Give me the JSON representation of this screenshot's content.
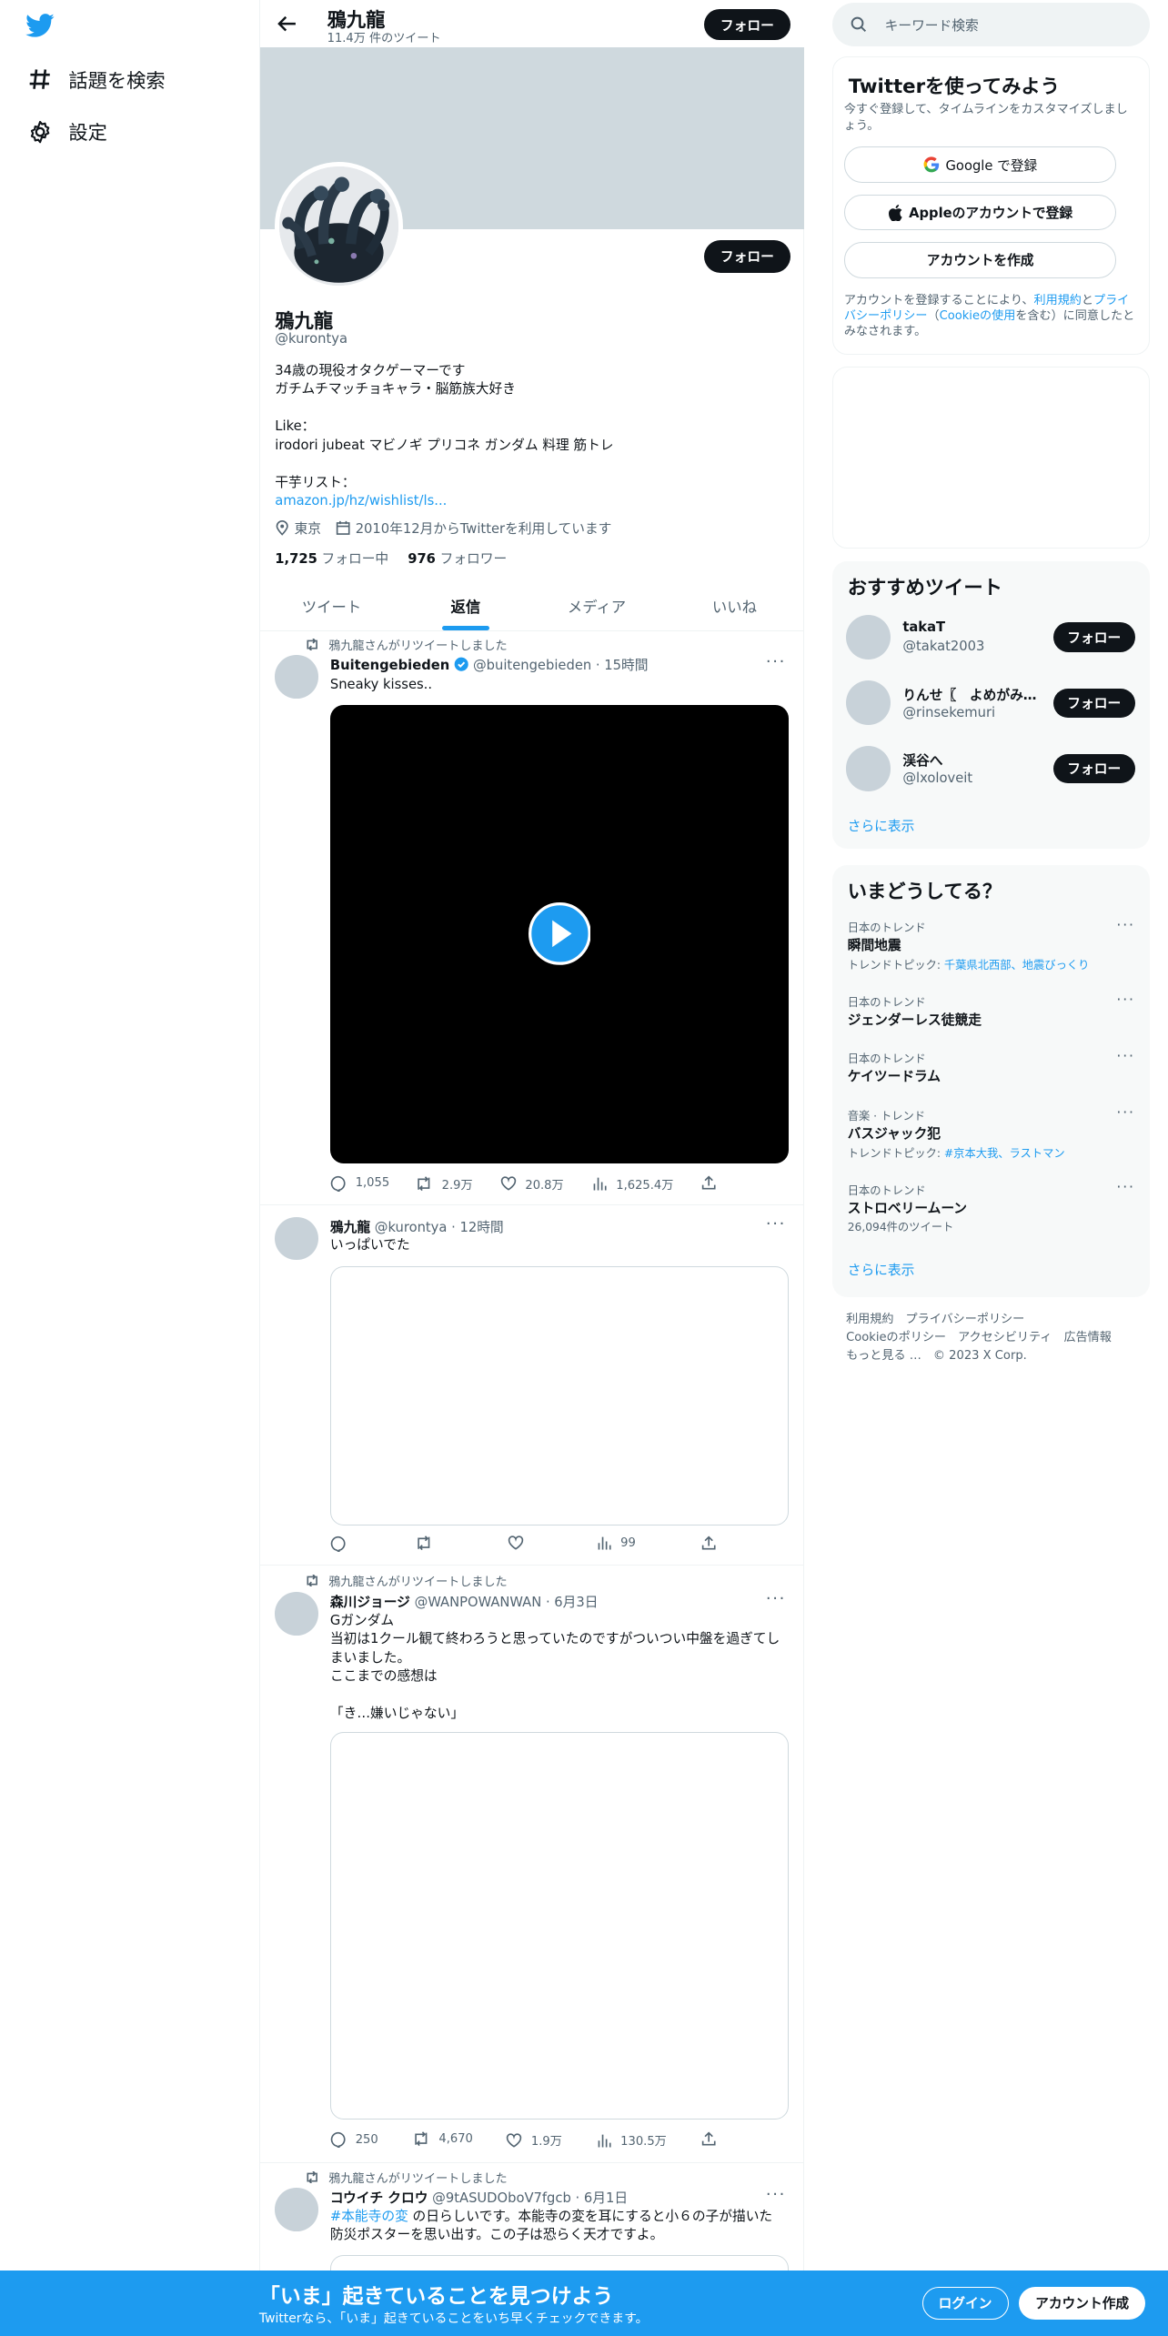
{
  "nav": {
    "explore_label": "話題を検索",
    "settings_label": "設定"
  },
  "profile": {
    "name": "鴉九龍",
    "tweet_count": "11.4万 件のツイート",
    "follow_label": "フォロー",
    "handle": "@kurontya",
    "bio_line1": "34歳の現役オタクゲーマーです",
    "bio_line2": "ガチムチマッチョキャラ・脳筋族大好き",
    "like_label": "Like：",
    "like_list": "irodori jubeat マビノギ プリコネ ガンダム 料理 筋トレ",
    "wishlist_label": "干芋リスト：",
    "wishlist_url": "amazon.jp/hz/wishlist/ls...",
    "location": "東京",
    "joined": "2010年12月からTwitterを利用しています",
    "following_count": "1,725",
    "following_label": " フォロー中",
    "followers_count": "976",
    "followers_label": " フォロワー"
  },
  "tabs": [
    "ツイート",
    "返信",
    "メディア",
    "いいね"
  ],
  "tweets": [
    {
      "retweet_label": "鴉九龍さんがリツイートしました",
      "name": "Buitengebieden",
      "handle": "@buitengebieden",
      "time": "· 15時間",
      "text": "Sneaky kisses..",
      "replies": "1,055",
      "retweets": "2.9万",
      "likes": "20.8万",
      "views": "1,625.4万"
    },
    {
      "name": "鴉九龍",
      "handle": "@kurontya",
      "time": "· 12時間",
      "text": "いっぱいでた",
      "views": "99"
    },
    {
      "retweet_label": "鴉九龍さんがリツイートしました",
      "name": "森川ジョージ",
      "handle": "@WANPOWANWAN",
      "time": "· 6月3日",
      "line1": "Gガンダム",
      "line2": "当初は1クール観て終わろうと思っていたのですがついつい中盤を過ぎてし",
      "line3": "まいました。",
      "line4": "ここまでの感想は",
      "line5": "「き…嫌いじゃない」",
      "replies": "250",
      "retweets": "4,670",
      "likes": "1.9万",
      "views": "130.5万"
    },
    {
      "retweet_label": "鴉九龍さんがリツイートしました",
      "name": "コウイチ クロウ",
      "handle": "@9tASUDOboV7fgcb",
      "time": "· 6月1日",
      "hashtag": "#本能寺の変",
      "line1_rest": " の日らしいです。本能寺の変を耳にすると小６の子が描いた",
      "line2": "防災ポスターを思い出す。この子は恐らく天才ですよ。"
    }
  ],
  "right": {
    "search_placeholder": "キーワード検索",
    "signup_title": "Twitterを使ってみよう",
    "signup_sub": "今すぐ登録して、タイムラインをカスタマイズしましょう。",
    "google_label": "Google で登録",
    "apple_label": "Appleのアカウントで登録",
    "create_label": "アカウントを作成",
    "terms_pre": "アカウントを登録することにより、",
    "terms_link1": "利用規約",
    "terms_and": "と",
    "terms_link2": "プライバシーポリシー",
    "terms_mid": "（",
    "terms_link3": "Cookieの使用",
    "terms_post": "を含む）に同意したとみなされます。",
    "rec_title": "おすすめツイート",
    "recs": [
      {
        "name": "takaT",
        "handle": "@takat2003"
      },
      {
        "name": "りんせ〖　よめがみ…",
        "handle": "@rinsekemuri"
      },
      {
        "name": "渓谷へ",
        "handle": "@lxoloveit"
      }
    ],
    "show_more": "さらに表示",
    "trends_title": "いまどうしてる？",
    "trends": [
      {
        "cat": "日本のトレンド",
        "name": "瞬間地震",
        "sub_pre": "トレンドトピック: ",
        "sub_link": "千葉県北西部、地震びっくり"
      },
      {
        "cat": "日本のトレンド",
        "name": "ジェンダーレス徒競走"
      },
      {
        "cat": "日本のトレンド",
        "name": "ケイツードラム"
      },
      {
        "cat": "音楽 · トレンド",
        "name": "バスジャック犯",
        "sub_pre": "トレンドトピック: ",
        "sub_link": "#京本大我、ラストマン"
      },
      {
        "cat": "日本のトレンド",
        "name": "ストロベリームーン",
        "sub_pre": "26,094件のツイート"
      }
    ],
    "footer1": "利用規約　プライバシーポリシー",
    "footer2": "Cookieのポリシー　アクセシビリティ　広告情報",
    "footer3": "もっと見る …　© 2023 X Corp."
  },
  "bottom": {
    "title": "「いま」起きていることを見つけよう",
    "subtitle": "Twitterなら、「いま」起きていることをいち早くチェックできます。",
    "login": "ログイン",
    "signup": "アカウント作成"
  }
}
